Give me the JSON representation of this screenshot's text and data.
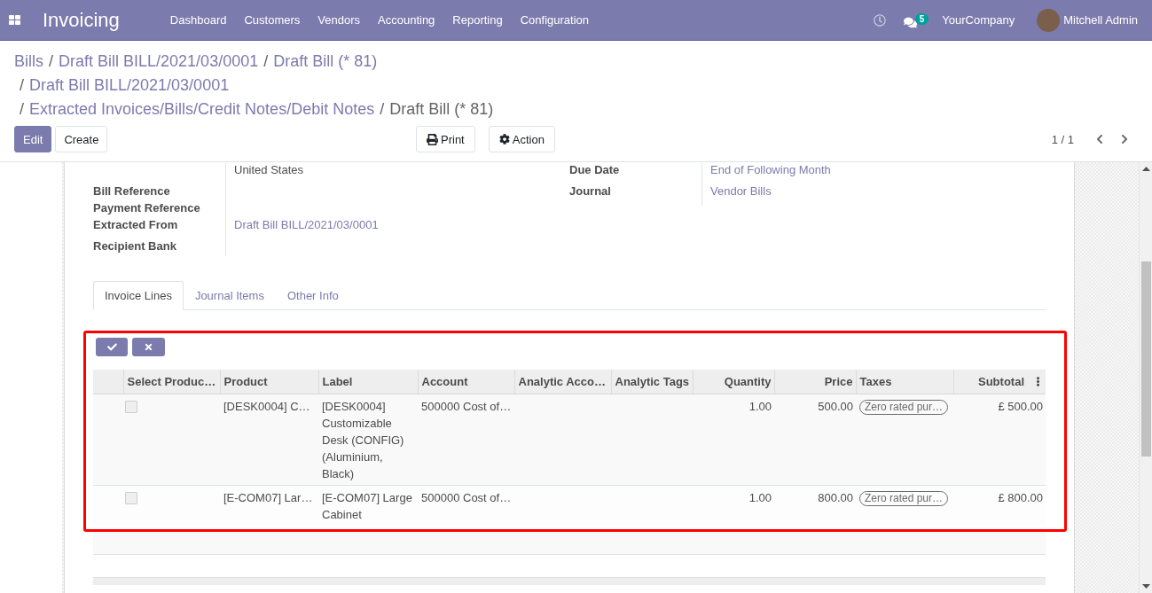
{
  "navbar": {
    "app_name": "Invoicing",
    "menu": [
      "Dashboard",
      "Customers",
      "Vendors",
      "Accounting",
      "Reporting",
      "Configuration"
    ],
    "message_count": "5",
    "company": "YourCompany",
    "user": "Mitchell Admin"
  },
  "breadcrumbs": [
    {
      "label": "Bills",
      "current": false
    },
    {
      "separator": "/",
      "label": "Draft Bill BILL/2021/03/0001",
      "current": false
    },
    {
      "separator": "/",
      "label": "Draft Bill (* 81)",
      "current": false
    },
    {
      "separator": "/",
      "label": "Draft Bill BILL/2021/03/0001",
      "current": false
    },
    {
      "separator": "/",
      "label": "Extracted Invoices/Bills/Credit Notes/Debit Notes",
      "current": false
    },
    {
      "separator": "/",
      "label": "Draft Bill (* 81)",
      "current": true
    }
  ],
  "buttons": [
    {
      "label": "Edit",
      "kind": "primary"
    },
    {
      "label": "Create",
      "kind": "secondary"
    }
  ],
  "actions": [
    "Print",
    "Action"
  ],
  "pager": "1 / 1",
  "form": {
    "left": [
      {
        "value": "United States",
        "kind": "text"
      },
      {
        "label": "Bill Reference",
        "kind": "label"
      },
      {
        "label": "Payment Reference",
        "kind": "label"
      },
      {
        "label": "Extracted From",
        "value": "Draft Bill BILL/2021/03/0001",
        "kind": "link"
      },
      {
        "label": "Recipient Bank",
        "kind": "label"
      }
    ],
    "right": [
      {
        "label": "Due Date",
        "value": "End of Following Month",
        "kind": "link"
      },
      {
        "label": "Journal",
        "value": "Vendor Bills",
        "kind": "link"
      }
    ]
  },
  "tabs": [
    {
      "label": "Invoice Lines",
      "selected": true
    },
    {
      "label": "Journal Items",
      "selected": false
    },
    {
      "label": "Other Info",
      "selected": false
    }
  ],
  "invoice_lines": {
    "highlighted": true,
    "columns": [
      {
        "label": "Select Produc…",
        "numeric": false
      },
      {
        "label": "Product",
        "numeric": false
      },
      {
        "label": "Label",
        "numeric": false
      },
      {
        "label": "Account",
        "numeric": false
      },
      {
        "label": "Analytic Acco…",
        "numeric": false
      },
      {
        "label": "Analytic Tags",
        "numeric": false
      },
      {
        "label": "Quantity",
        "numeric": true
      },
      {
        "label": "Price",
        "numeric": true
      },
      {
        "label": "Taxes",
        "numeric": false
      },
      {
        "label": "Subtotal",
        "numeric": true
      }
    ],
    "rows": [
      {
        "checked": false,
        "product": "[DESK0004] C…",
        "label": "[DESK0004] Customizable Desk (CONFIG) (Aluminium, Black)",
        "account": "500000 Cost of…",
        "quantity": "1.00",
        "price": "500.00",
        "taxes": [
          "Zero rated pur…"
        ],
        "subtotal": "£ 500.00"
      },
      {
        "checked": false,
        "product": "[E-COM07] Lar…",
        "label": "[E-COM07] Large Cabinet",
        "account": "500000 Cost of…",
        "quantity": "1.00",
        "price": "800.00",
        "taxes": [
          "Zero rated pur…"
        ],
        "subtotal": "£ 800.00"
      }
    ]
  }
}
